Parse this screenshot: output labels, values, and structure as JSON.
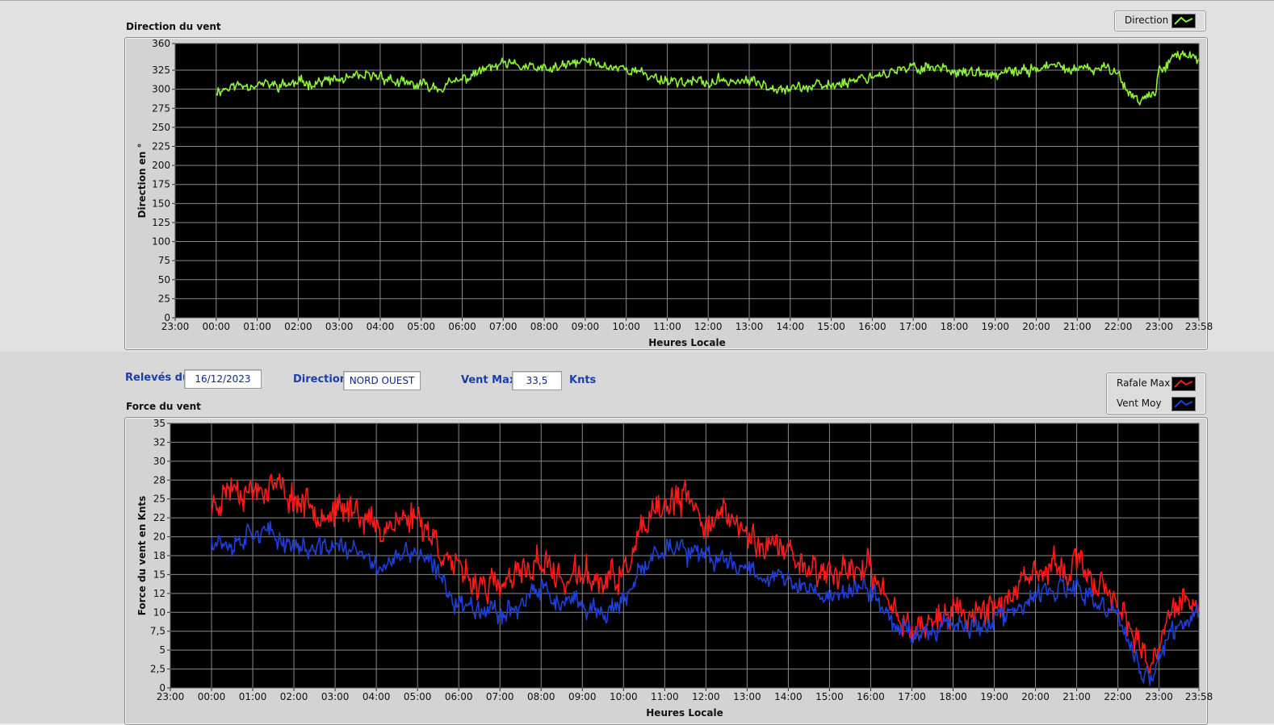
{
  "direction_chart": {
    "title": "Direction du vent",
    "legend": [
      {
        "label": "Direction",
        "color": "#8ef23a"
      }
    ]
  },
  "form": {
    "date_label": "Relevés du",
    "date_value": "16/12/2023",
    "direction_label": "Direction",
    "direction_value": "NORD OUEST",
    "vent_max_label": "Vent Max",
    "vent_max_value": "33,5",
    "unit": "Knts"
  },
  "force_chart": {
    "title": "Force du vent",
    "legend": [
      {
        "label": "Rafale Max",
        "color": "#ff1a1a"
      },
      {
        "label": "Vent Moy",
        "color": "#1f3fd6"
      }
    ]
  },
  "chart_data": [
    {
      "type": "line",
      "title": "Direction du vent",
      "xlabel": "Heures Locale",
      "ylabel": "Direction en °",
      "xlim": [
        -1,
        23.967
      ],
      "ylim": [
        0,
        360
      ],
      "grid": true,
      "legend_position": "top-right",
      "xticks": [
        "23:00",
        "00:00",
        "01:00",
        "02:00",
        "03:00",
        "04:00",
        "05:00",
        "06:00",
        "07:00",
        "08:00",
        "09:00",
        "10:00",
        "11:00",
        "12:00",
        "13:00",
        "14:00",
        "15:00",
        "16:00",
        "17:00",
        "18:00",
        "19:00",
        "20:00",
        "21:00",
        "22:00",
        "23:00",
        "23:58"
      ],
      "yticks": [
        "0",
        "25",
        "50",
        "75",
        "100",
        "125",
        "150",
        "175",
        "200",
        "225",
        "250",
        "275",
        "300",
        "325",
        "360"
      ],
      "ytick_values": [
        0,
        25,
        50,
        75,
        100,
        125,
        150,
        175,
        200,
        225,
        250,
        275,
        300,
        325,
        360
      ],
      "x": [
        0,
        0.5,
        1,
        1.5,
        2,
        2.5,
        3,
        3.5,
        4,
        4.5,
        5,
        5.5,
        6,
        6.5,
        7,
        7.5,
        8,
        8.5,
        9,
        9.5,
        10,
        10.5,
        11,
        11.5,
        12,
        12.5,
        13,
        13.5,
        14,
        14.5,
        15,
        15.5,
        16,
        16.5,
        17,
        17.5,
        18,
        18.5,
        19,
        19.5,
        20,
        20.5,
        21,
        21.5,
        22,
        22.1,
        22.5,
        22.9,
        23,
        23.3,
        23.6,
        23.967
      ],
      "series": [
        {
          "name": "Direction",
          "color": "#8ef23a",
          "values": [
            298,
            305,
            307,
            305,
            308,
            310,
            312,
            315,
            318,
            307,
            305,
            303,
            312,
            325,
            332,
            330,
            325,
            330,
            338,
            330,
            328,
            318,
            312,
            310,
            308,
            312,
            310,
            305,
            302,
            303,
            305,
            312,
            318,
            322,
            328,
            330,
            325,
            320,
            318,
            322,
            328,
            330,
            325,
            326,
            328,
            305,
            285,
            295,
            325,
            342,
            345,
            340
          ]
        }
      ]
    },
    {
      "type": "line",
      "title": "Force du vent",
      "xlabel": "Heures Locale",
      "ylabel": "Force du vent en Knts",
      "xlim": [
        -1,
        23.967
      ],
      "ylim": [
        0,
        35
      ],
      "grid": true,
      "legend_position": "top-right",
      "xticks": [
        "23:00",
        "00:00",
        "01:00",
        "02:00",
        "03:00",
        "04:00",
        "05:00",
        "06:00",
        "07:00",
        "08:00",
        "09:00",
        "10:00",
        "11:00",
        "12:00",
        "13:00",
        "14:00",
        "15:00",
        "16:00",
        "17:00",
        "18:00",
        "19:00",
        "20:00",
        "21:00",
        "22:00",
        "23:00",
        "23:58"
      ],
      "yticks": [
        "0",
        "2,5",
        "5",
        "7,5",
        "10",
        "12",
        "15",
        "18",
        "20",
        "22",
        "25",
        "28",
        "30",
        "32",
        "35"
      ],
      "ytick_values": [
        0,
        2.5,
        5,
        7.5,
        10,
        12.5,
        15,
        17.5,
        20,
        22.5,
        25,
        27.5,
        30,
        32.5,
        35
      ],
      "x": [
        0,
        0.5,
        1,
        1.5,
        2,
        2.5,
        3,
        3.5,
        4,
        4.5,
        5,
        5.5,
        6,
        6.5,
        7,
        7.5,
        8,
        8.5,
        9,
        9.5,
        10,
        10.5,
        11,
        11.5,
        12,
        12.5,
        13,
        13.5,
        14,
        14.5,
        15,
        15.5,
        16,
        16.5,
        17,
        17.5,
        18,
        18.5,
        19,
        19.5,
        20,
        20.5,
        21,
        21.5,
        22,
        22.3,
        22.6,
        22.8,
        23,
        23.3,
        23.6,
        23.967
      ],
      "series": [
        {
          "name": "Rafale Max",
          "color": "#ff1a1a",
          "values": [
            24,
            27,
            26,
            27,
            25,
            24,
            23,
            24,
            21,
            22,
            23,
            19,
            15,
            14,
            13,
            15,
            17,
            14,
            15,
            14,
            15,
            21,
            24,
            25,
            22,
            23,
            20,
            19,
            18,
            16,
            15,
            16,
            15,
            11,
            8,
            9,
            10,
            10,
            11,
            12,
            15,
            16,
            16,
            14,
            12,
            7,
            4,
            2,
            6,
            10,
            12,
            11
          ]
        },
        {
          "name": "Vent Moy",
          "color": "#1f3fd6",
          "values": [
            20,
            19,
            21,
            20,
            19,
            18,
            19,
            18,
            16,
            17,
            18,
            15,
            11,
            11,
            10,
            11,
            13,
            11,
            11,
            10,
            11,
            16,
            19,
            18,
            17,
            17,
            16,
            15,
            14,
            13,
            12,
            13,
            13,
            9,
            7,
            8,
            9,
            8,
            9,
            10,
            12,
            13,
            13,
            11,
            10,
            5,
            2,
            1,
            4,
            7,
            9,
            10
          ]
        }
      ]
    }
  ]
}
